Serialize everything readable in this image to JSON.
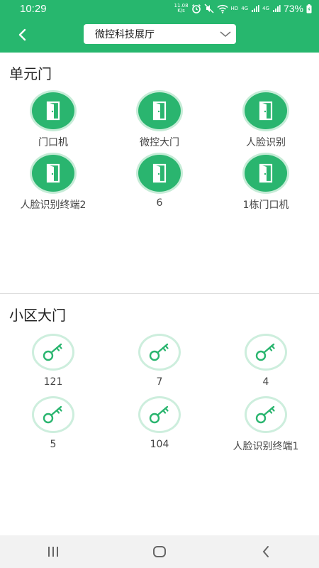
{
  "status_bar": {
    "time": "10:29",
    "net_speed_value": "11.08",
    "net_speed_unit": "K/s",
    "hd_label": "HD",
    "network_type_1": "4G",
    "network_type_2": "4G",
    "battery_percent": "73%"
  },
  "header": {
    "selected_location": "微控科技展厅",
    "background_color": "#27b76e"
  },
  "sections": [
    {
      "title": "单元门",
      "icon": "door-icon",
      "items": [
        {
          "label": "门口机"
        },
        {
          "label": "微控大门"
        },
        {
          "label": "人脸识别"
        },
        {
          "label": "人脸识别终端2"
        },
        {
          "label": "6"
        },
        {
          "label": "1栋门口机"
        }
      ]
    },
    {
      "title": "小区大门",
      "icon": "key-icon",
      "items": [
        {
          "label": "121"
        },
        {
          "label": "7"
        },
        {
          "label": "4"
        },
        {
          "label": "5"
        },
        {
          "label": "104"
        },
        {
          "label": "人脸识别终端1"
        }
      ]
    }
  ],
  "nav_bar": {
    "icons": [
      "recent-apps-icon",
      "home-icon",
      "back-icon"
    ]
  }
}
